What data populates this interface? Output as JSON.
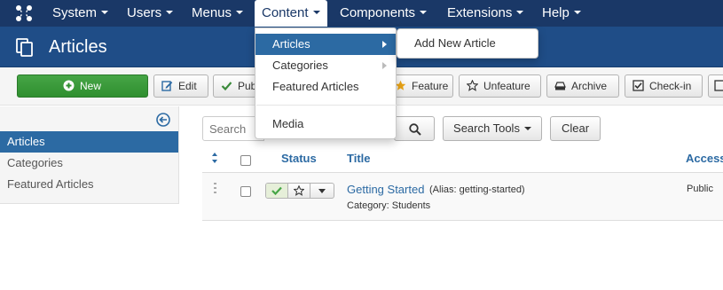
{
  "navbar": {
    "logo_icon": "joomla-logo-icon",
    "items": [
      {
        "label": "System"
      },
      {
        "label": "Users"
      },
      {
        "label": "Menus"
      },
      {
        "label": "Content"
      },
      {
        "label": "Components"
      },
      {
        "label": "Extensions"
      },
      {
        "label": "Help"
      }
    ],
    "open_item": "Content"
  },
  "titlebar": {
    "title": "Articles",
    "icon": "stack-icon"
  },
  "toolbar": {
    "buttons": [
      {
        "label": "New",
        "icon": "plus-circle-icon"
      },
      {
        "label": "Edit",
        "icon": "edit-icon"
      },
      {
        "label": "Publish",
        "icon": "check-icon"
      },
      {
        "label": "Feature",
        "icon": "star-icon"
      },
      {
        "label": "Unfeature",
        "icon": "star-outline-icon"
      },
      {
        "label": "Archive",
        "icon": "archive-icon"
      },
      {
        "label": "Check-in",
        "icon": "checkbox-icon"
      }
    ]
  },
  "sidebar": {
    "collapse_icon": "arrow-left-circle-icon",
    "items": [
      {
        "label": "Articles",
        "active": true
      },
      {
        "label": "Categories"
      },
      {
        "label": "Featured Articles"
      }
    ]
  },
  "filters": {
    "search_placeholder": "Search",
    "search_icon": "search-icon",
    "search_tools_label": "Search Tools",
    "clear_label": "Clear"
  },
  "table": {
    "headers": {
      "status": "Status",
      "title": "Title",
      "access": "Access"
    },
    "rows": [
      {
        "title": "Getting Started",
        "alias": "(Alias: getting-started)",
        "category": "Category: Students",
        "access": "Public",
        "published": true
      }
    ]
  },
  "content_menu": {
    "items": [
      {
        "label": "Articles",
        "has_submenu": true
      },
      {
        "label": "Categories",
        "has_submenu": true
      },
      {
        "label": "Featured Articles"
      },
      {
        "label": "Media"
      }
    ],
    "submenu": {
      "label": "Add New Article"
    }
  },
  "colors": {
    "navbar": "#1a3867",
    "titlebar": "#1f4d87",
    "accent": "#2c6aa3",
    "success": "#46a546"
  }
}
